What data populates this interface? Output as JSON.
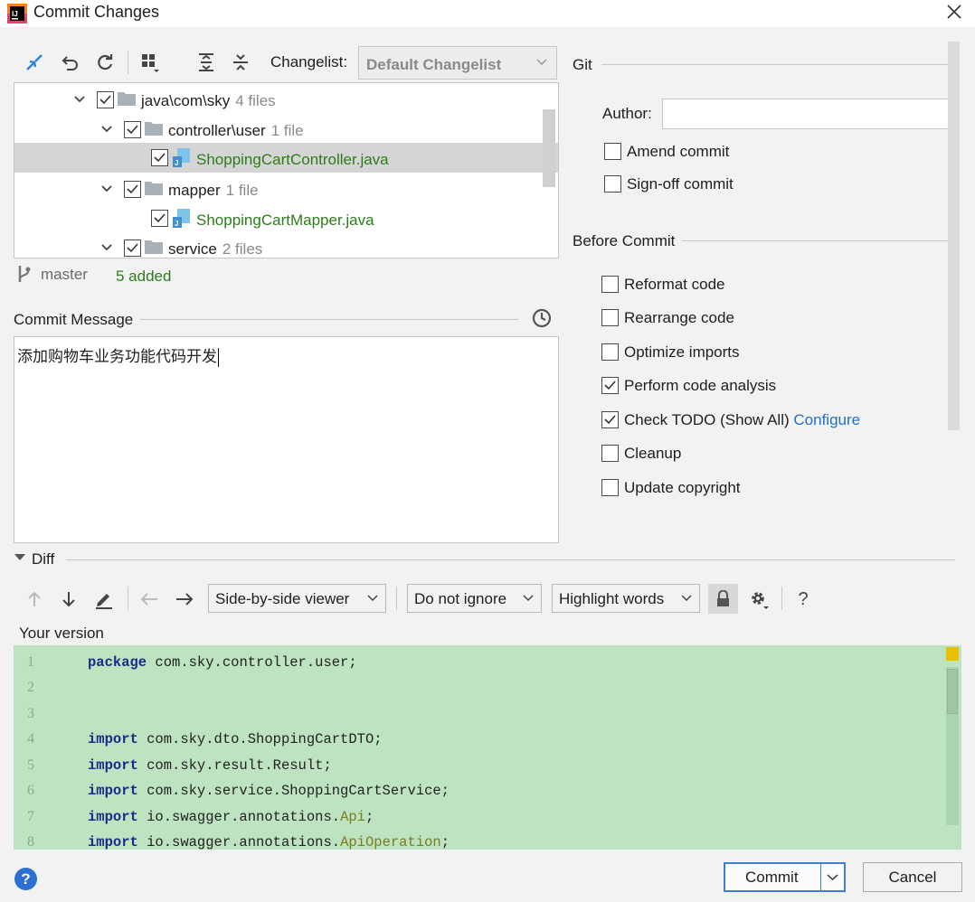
{
  "window": {
    "title": "Commit Changes"
  },
  "toolbar": {
    "changelist_label": "Changelist:",
    "changelist_value": "Default Changelist"
  },
  "tree": {
    "rows": [
      {
        "label": "java\\com\\sky",
        "count": "4 files"
      },
      {
        "label": "controller\\user",
        "count": "1 file"
      },
      {
        "label": "ShoppingCartController.java",
        "count": ""
      },
      {
        "label": "mapper",
        "count": "1 file"
      },
      {
        "label": "ShoppingCartMapper.java",
        "count": ""
      },
      {
        "label": "service",
        "count": "2 files"
      }
    ]
  },
  "status": {
    "branch": "master",
    "added": "5 added"
  },
  "commit_message": {
    "label": "Commit Message",
    "text": "添加购物车业务功能代码开发"
  },
  "git": {
    "title": "Git",
    "author_label": "Author:",
    "author_value": "",
    "amend": "Amend commit",
    "signoff": "Sign-off commit"
  },
  "before_commit": {
    "title": "Before Commit",
    "options": [
      {
        "label": "Reformat code",
        "checked": false
      },
      {
        "label": "Rearrange code",
        "checked": false
      },
      {
        "label": "Optimize imports",
        "checked": false
      },
      {
        "label": "Perform code analysis",
        "checked": true
      },
      {
        "label": "Check TODO (Show All)",
        "checked": true,
        "link": "Configure"
      },
      {
        "label": "Cleanup",
        "checked": false
      },
      {
        "label": "Update copyright",
        "checked": false
      }
    ]
  },
  "diff": {
    "label": "Diff",
    "viewer": "Side-by-side viewer",
    "ignore": "Do not ignore",
    "highlight": "Highlight words",
    "help": "?",
    "your_version": "Your version",
    "lines": [
      {
        "num": "1",
        "kw": "package",
        "rest": " com.sky.controller.user;"
      },
      {
        "num": "2",
        "kw": "",
        "rest": ""
      },
      {
        "num": "3",
        "kw": "",
        "rest": ""
      },
      {
        "num": "4",
        "kw": "import",
        "rest": " com.sky.dto.ShoppingCartDTO;"
      },
      {
        "num": "5",
        "kw": "import",
        "rest": " com.sky.result.Result;"
      },
      {
        "num": "6",
        "kw": "import",
        "rest": " com.sky.service.ShoppingCartService;"
      },
      {
        "num": "7",
        "kw": "import",
        "rest": " io.swagger.annotations.",
        "ann": "Api",
        "tail": ";"
      },
      {
        "num": "8",
        "kw": "import",
        "rest": " io.swagger.annotations.",
        "ann": "ApiOperation",
        "tail": ";"
      }
    ]
  },
  "buttons": {
    "commit": "Commit",
    "cancel": "Cancel",
    "help": "?"
  },
  "colors": {
    "accent": "#3d7fd4",
    "added_green": "#2c7d1a",
    "diff_bg": "#bde3c0",
    "link": "#2470c2"
  }
}
